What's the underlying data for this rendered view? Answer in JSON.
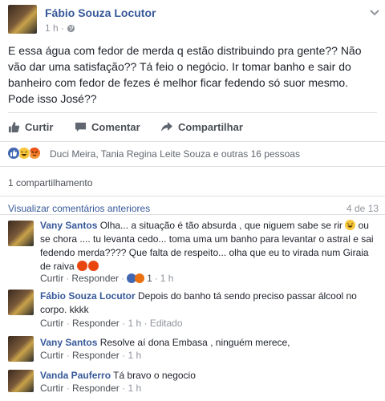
{
  "post": {
    "author": "Fábio Souza Locutor",
    "time": "1 h",
    "body": "E essa água com fedor de merda q estão distribuindo pra gente?? Não vão dar uma satisfação?? Tá feio o negócio. Ir tomar banho e sair do banheiro com fedor de fezes é melhor ficar fedendo só suor mesmo. Pode isso José??"
  },
  "actions": {
    "like": "Curtir",
    "comment": "Comentar",
    "share": "Compartilhar"
  },
  "reactions_text": "Duci Meira, Tania Regina Leite Souza e outras 16 pessoas",
  "shares_text": "1 compartilhamento",
  "comments_bar": {
    "view_previous": "Visualizar comentários anteriores",
    "count": "4 de 13"
  },
  "comments": [
    {
      "name": "Vany Santos",
      "text1": " Olha... a situação é tão absurda , que niguem sabe se rir ",
      "text2": " ou se chora .... tu levanta cedo... toma uma um banho para levantar o astral e sai fedendo merda???? Que falta de respeito... olha que eu to virada num Giraia de raiva",
      "like": "Curtir",
      "reply": "Responder",
      "reaction_count": "1",
      "time": "1 h"
    },
    {
      "name": "Fábio Souza Locutor",
      "text": " Depois do banho tá sendo preciso passar álcool no corpo. kkkk",
      "like": "Curtir",
      "reply": "Responder",
      "time": "1 h",
      "edited": "Editado"
    },
    {
      "name": "Vany Santos",
      "text": " Resolve aí dona Embasa , ninguém merece,",
      "like": "Curtir",
      "reply": "Responder",
      "time": "1 h"
    },
    {
      "name": "Vanda Pauferro",
      "text": " Tá bravo o negocio",
      "like": "Curtir",
      "reply": "Responder",
      "time": "1 h"
    }
  ],
  "icons": [
    "chevron-down-icon",
    "globe-icon",
    "like-icon",
    "comment-icon",
    "share-icon",
    "like-reaction-icon",
    "haha-reaction-icon",
    "angry-reaction-icon",
    "laughing-emoji-icon",
    "angry-emoji-icon"
  ],
  "colors": {
    "link": "#365899",
    "like_blue": "#4267b2",
    "haha_yellow": "#f7c53b",
    "angry_red": "#e9710f",
    "meta_gray": "#90949c"
  }
}
